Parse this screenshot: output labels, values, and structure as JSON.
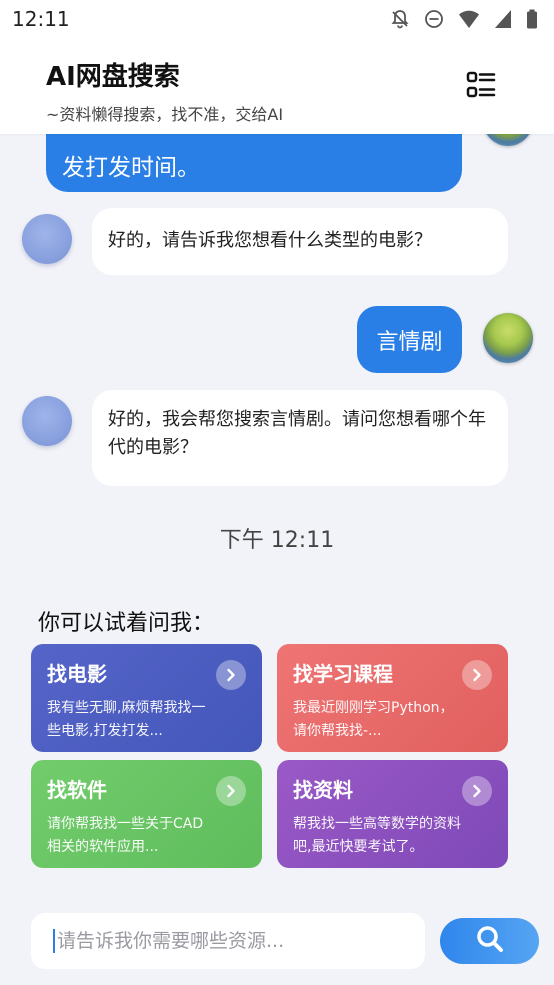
{
  "status_bar": {
    "time": "12:11"
  },
  "header": {
    "title": "AI网盘搜索",
    "subtitle": "~资料懒得搜索，找不准，交给AI"
  },
  "chat": {
    "messages": [
      {
        "role": "user",
        "text": "发打发时间。"
      },
      {
        "role": "bot",
        "text": "好的，请告诉我您想看什么类型的电影？"
      },
      {
        "role": "user",
        "text": "言情剧"
      },
      {
        "role": "bot",
        "text": "好的，我会帮您搜索言情剧。请问您想看哪个年代的电影？"
      }
    ],
    "timestamp": "下午 12:11"
  },
  "suggestions": {
    "title": "你可以试着问我：",
    "cards": [
      {
        "title": "找电影",
        "desc": "我有些无聊,麻烦帮我找一些电影,打发打发...",
        "color": "#4a5cc0"
      },
      {
        "title": "找学习课程",
        "desc": "我最近刚刚学习Python，请你帮我找-...",
        "color": "#e56766"
      },
      {
        "title": "找软件",
        "desc": "请你帮我找一些关于CAD相关的软件应用...",
        "color": "#66c462"
      },
      {
        "title": "找资料",
        "desc": "帮我找一些高等数学的资料吧,最近快要考试了。",
        "color": "#8a50bf"
      }
    ]
  },
  "input": {
    "placeholder": "请告诉我你需要哪些资源..."
  },
  "colors": {
    "primary": "#2a7fe6",
    "background": "#f2f3f8"
  }
}
